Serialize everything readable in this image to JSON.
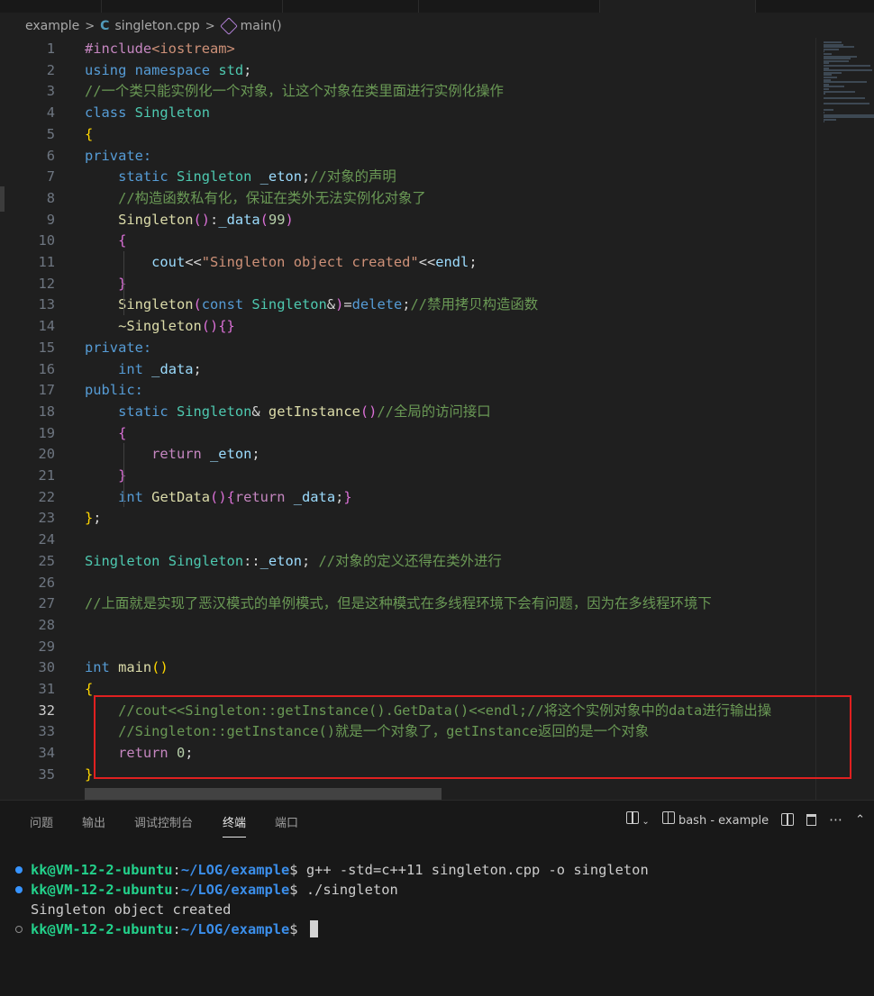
{
  "breadcrumb": {
    "folder": "example",
    "file": "singleton.cpp",
    "symbol": "main()"
  },
  "editor": {
    "lines": [
      {
        "n": 1,
        "tokens": [
          [
            "pp",
            "#include"
          ],
          [
            "st",
            "<iostream>"
          ]
        ]
      },
      {
        "n": 2,
        "tokens": [
          [
            "kw",
            "using"
          ],
          [
            "id",
            " "
          ],
          [
            "kw",
            "namespace"
          ],
          [
            "id",
            " "
          ],
          [
            "ty",
            "std"
          ],
          [
            "id",
            ";"
          ]
        ]
      },
      {
        "n": 3,
        "tokens": [
          [
            "cm",
            "//一个类只能实例化一个对象，让这个对象在类里面进行实例化操作"
          ]
        ]
      },
      {
        "n": 4,
        "tokens": [
          [
            "kw",
            "class"
          ],
          [
            "id",
            " "
          ],
          [
            "ty",
            "Singleton"
          ]
        ]
      },
      {
        "n": 5,
        "tokens": [
          [
            "b1",
            "{"
          ]
        ]
      },
      {
        "n": 6,
        "tokens": [
          [
            "kw",
            "private:"
          ]
        ]
      },
      {
        "n": 7,
        "tokens": [
          [
            "id",
            "    "
          ],
          [
            "kw",
            "static"
          ],
          [
            "id",
            " "
          ],
          [
            "ty",
            "Singleton"
          ],
          [
            "id",
            " "
          ],
          [
            "va",
            "_eton"
          ],
          [
            "id",
            ";"
          ],
          [
            "cm",
            "//对象的声明"
          ]
        ]
      },
      {
        "n": 8,
        "tokens": [
          [
            "id",
            "    "
          ],
          [
            "cm",
            "//构造函数私有化，保证在类外无法实例化对象了"
          ]
        ]
      },
      {
        "n": 9,
        "tokens": [
          [
            "id",
            "    "
          ],
          [
            "fn",
            "Singleton"
          ],
          [
            "b2",
            "()"
          ],
          [
            "id",
            ":"
          ],
          [
            "va",
            "_data"
          ],
          [
            "b2",
            "("
          ],
          [
            "nu",
            "99"
          ],
          [
            "b2",
            ")"
          ]
        ]
      },
      {
        "n": 10,
        "tokens": [
          [
            "id",
            "    "
          ],
          [
            "b2",
            "{"
          ]
        ]
      },
      {
        "n": 11,
        "tokens": [
          [
            "id",
            "        "
          ],
          [
            "va",
            "cout"
          ],
          [
            "id",
            "<<"
          ],
          [
            "st",
            "\"Singleton object created\""
          ],
          [
            "id",
            "<<"
          ],
          [
            "va",
            "endl"
          ],
          [
            "id",
            ";"
          ]
        ]
      },
      {
        "n": 12,
        "tokens": [
          [
            "id",
            "    "
          ],
          [
            "b2",
            "}"
          ]
        ]
      },
      {
        "n": 13,
        "tokens": [
          [
            "id",
            "    "
          ],
          [
            "fn",
            "Singleton"
          ],
          [
            "b2",
            "("
          ],
          [
            "kw",
            "const"
          ],
          [
            "id",
            " "
          ],
          [
            "ty",
            "Singleton"
          ],
          [
            "id",
            "&"
          ],
          [
            "b2",
            ")"
          ],
          [
            "id",
            "="
          ],
          [
            "kw",
            "delete"
          ],
          [
            "id",
            ";"
          ],
          [
            "cm",
            "//禁用拷贝构造函数"
          ]
        ]
      },
      {
        "n": 14,
        "tokens": [
          [
            "id",
            "    "
          ],
          [
            "fn",
            "~Singleton"
          ],
          [
            "b2",
            "(){}"
          ]
        ]
      },
      {
        "n": 15,
        "tokens": [
          [
            "kw",
            "private:"
          ]
        ]
      },
      {
        "n": 16,
        "tokens": [
          [
            "id",
            "    "
          ],
          [
            "kw",
            "int"
          ],
          [
            "id",
            " "
          ],
          [
            "va",
            "_data"
          ],
          [
            "id",
            ";"
          ]
        ]
      },
      {
        "n": 17,
        "tokens": [
          [
            "kw",
            "public:"
          ]
        ]
      },
      {
        "n": 18,
        "tokens": [
          [
            "id",
            "    "
          ],
          [
            "kw",
            "static"
          ],
          [
            "id",
            " "
          ],
          [
            "ty",
            "Singleton"
          ],
          [
            "id",
            "& "
          ],
          [
            "fn",
            "getInstance"
          ],
          [
            "b2",
            "()"
          ],
          [
            "cm",
            "//全局的访问接口"
          ]
        ]
      },
      {
        "n": 19,
        "tokens": [
          [
            "id",
            "    "
          ],
          [
            "b2",
            "{"
          ]
        ]
      },
      {
        "n": 20,
        "tokens": [
          [
            "id",
            "        "
          ],
          [
            "pp",
            "return"
          ],
          [
            "id",
            " "
          ],
          [
            "va",
            "_eton"
          ],
          [
            "id",
            ";"
          ]
        ]
      },
      {
        "n": 21,
        "tokens": [
          [
            "id",
            "    "
          ],
          [
            "b2",
            "}"
          ]
        ]
      },
      {
        "n": 22,
        "tokens": [
          [
            "id",
            "    "
          ],
          [
            "kw",
            "int"
          ],
          [
            "id",
            " "
          ],
          [
            "fn",
            "GetData"
          ],
          [
            "b2",
            "(){"
          ],
          [
            "pp",
            "return"
          ],
          [
            "id",
            " "
          ],
          [
            "va",
            "_data"
          ],
          [
            "id",
            ";"
          ],
          [
            "b2",
            "}"
          ]
        ]
      },
      {
        "n": 23,
        "tokens": [
          [
            "b1",
            "}"
          ],
          [
            "id",
            ";"
          ]
        ]
      },
      {
        "n": 24,
        "tokens": []
      },
      {
        "n": 25,
        "tokens": [
          [
            "ty",
            "Singleton"
          ],
          [
            "id",
            " "
          ],
          [
            "ty",
            "Singleton"
          ],
          [
            "id",
            "::"
          ],
          [
            "va",
            "_eton"
          ],
          [
            "id",
            "; "
          ],
          [
            "cm",
            "//对象的定义还得在类外进行"
          ]
        ]
      },
      {
        "n": 26,
        "tokens": []
      },
      {
        "n": 27,
        "tokens": [
          [
            "cm",
            "//上面就是实现了恶汉模式的单例模式，但是这种模式在多线程环境下会有问题，因为在多线程环境下"
          ]
        ]
      },
      {
        "n": 28,
        "tokens": []
      },
      {
        "n": 29,
        "tokens": []
      },
      {
        "n": 30,
        "tokens": [
          [
            "kw",
            "int"
          ],
          [
            "id",
            " "
          ],
          [
            "fn",
            "main"
          ],
          [
            "b1",
            "()"
          ]
        ]
      },
      {
        "n": 31,
        "tokens": [
          [
            "b1",
            "{"
          ]
        ]
      },
      {
        "n": 32,
        "tokens": [
          [
            "id",
            "    "
          ],
          [
            "cm",
            "//cout<<Singleton::getInstance().GetData()<<endl;//将这个实例对象中的data进行输出操"
          ]
        ]
      },
      {
        "n": 33,
        "tokens": [
          [
            "id",
            "    "
          ],
          [
            "cm",
            "//Singleton::getInstance()就是一个对象了，getInstance返回的是一个对象"
          ]
        ]
      },
      {
        "n": 34,
        "tokens": [
          [
            "id",
            "    "
          ],
          [
            "pp",
            "return"
          ],
          [
            "id",
            " "
          ],
          [
            "nu",
            "0"
          ],
          [
            "id",
            ";"
          ]
        ]
      },
      {
        "n": 35,
        "tokens": [
          [
            "b1",
            "}"
          ]
        ]
      }
    ],
    "current_line": 32
  },
  "panel": {
    "tabs": [
      "问题",
      "输出",
      "调试控制台",
      "终端",
      "端口"
    ],
    "active_tab": "终端",
    "terminal_name": "bash - example"
  },
  "terminal": {
    "user": "kk@VM-12-2-ubuntu",
    "path": "~/LOG/example",
    "lines": [
      {
        "type": "prompt",
        "cmd": " g++ -std=c++11 singleton.cpp -o singleton"
      },
      {
        "type": "prompt",
        "cmd": " ./singleton"
      },
      {
        "type": "output",
        "text": "Singleton object created"
      },
      {
        "type": "prompt",
        "cmd": " "
      }
    ]
  },
  "colors": {
    "accent_red_box": "#e02020",
    "prompt_user": "#23d18b",
    "prompt_path": "#3b8eea"
  }
}
